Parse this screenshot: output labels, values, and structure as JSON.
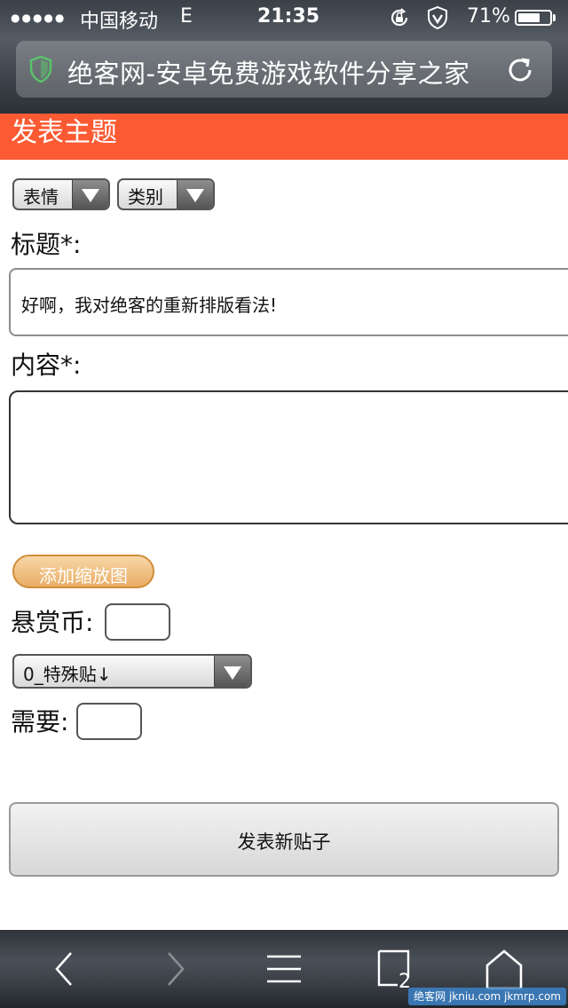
{
  "status_bar": {
    "signal_dots": "●●●●●",
    "carrier": "中国移动",
    "network": "E",
    "time": "21:35",
    "battery_text": "71%",
    "battery_level": 0.71
  },
  "browser": {
    "page_title": "绝客网-安卓免费游戏软件分享之家",
    "tab_count": "2"
  },
  "form": {
    "header_title": "发表主题",
    "emotion_select": "表情",
    "category_select": "类别",
    "title_label": "标题*:",
    "title_value": "好啊，我对绝客的重新排版看法!",
    "content_label": "内容*:",
    "content_value": "",
    "add_thumbnail_label": "添加缩放图",
    "reward_label": "悬赏币:",
    "reward_value": "",
    "special_post_select": "0_特殊贴↓",
    "require_label": "需要:",
    "require_value": "",
    "submit_label": "发表新贴子"
  },
  "watermark": "绝客网 jkniu.com jkmrp.com",
  "colors": {
    "header_bg": "#fc5a33",
    "orange_button": "#e9ad66",
    "secure_shield": "#59c36a"
  },
  "icons": {
    "lock_rotation": "lock-rotation-icon",
    "vpn": "vpn-shield-icon",
    "secure": "secure-shield-icon",
    "reload": "reload-icon",
    "back": "back-icon",
    "forward": "forward-icon",
    "menu": "menu-icon",
    "tabs": "tabs-icon",
    "home": "home-icon"
  }
}
